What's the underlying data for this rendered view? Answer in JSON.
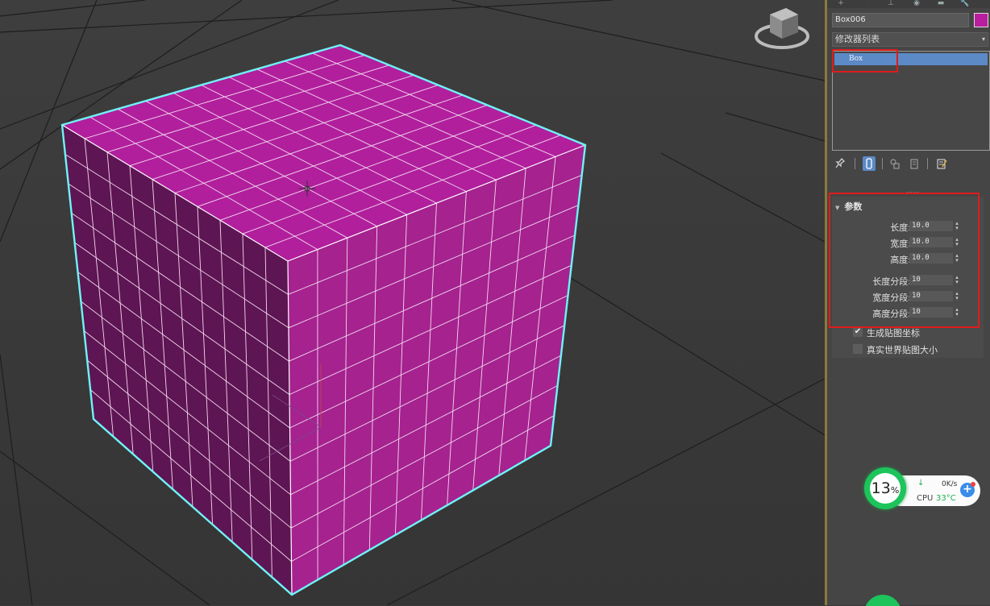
{
  "viewport": {
    "label": "3D perspective viewport",
    "object_color": "#b11f9d",
    "selection_color": "#6ff3f7",
    "grid_segments": 10
  },
  "tabs": [
    "+",
    "⌒",
    "⊥",
    "◉",
    "▬",
    "🔧"
  ],
  "object": {
    "name": "Box006",
    "color": "#b81e9e"
  },
  "modifier_list": {
    "label": "修改器列表",
    "arrow": "▾"
  },
  "modifier_stack": {
    "items": [
      "Box"
    ]
  },
  "params": {
    "title": "参数",
    "rows": [
      {
        "label": "长度:",
        "value": "10.0"
      },
      {
        "label": "宽度:",
        "value": "10.0"
      },
      {
        "label": "高度:",
        "value": "10.0"
      },
      {
        "label": "长度分段:",
        "value": "10"
      },
      {
        "label": "宽度分段:",
        "value": "10"
      },
      {
        "label": "高度分段:",
        "value": "10"
      }
    ],
    "checkboxes": [
      {
        "label": "生成贴图坐标",
        "checked": true,
        "mark": "✔"
      },
      {
        "label": "真实世界贴图大小",
        "checked": false,
        "mark": ""
      }
    ]
  },
  "cpu_widget": {
    "percent": "13",
    "percent_sign": "%",
    "net_rate": "0K/s",
    "cpu_label": "CPU",
    "cpu_temp": "33°C"
  }
}
